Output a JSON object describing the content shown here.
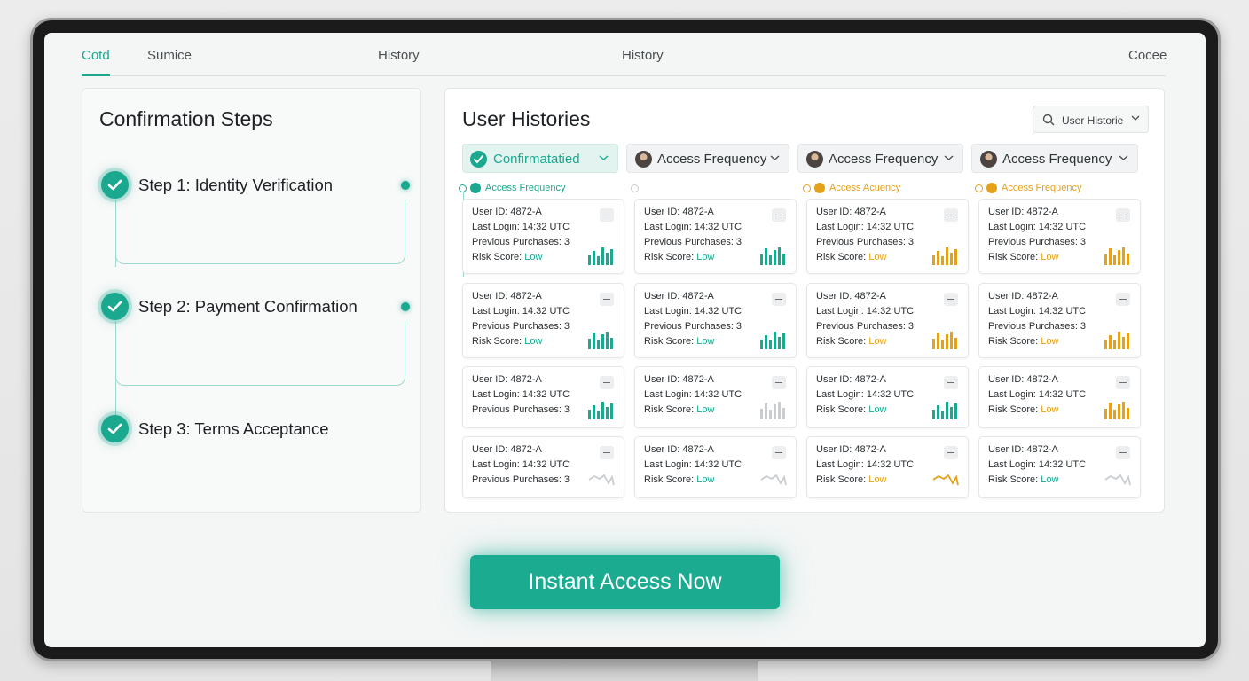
{
  "tabs": [
    {
      "label": "Cotd",
      "active": true
    },
    {
      "label": "Sumice",
      "active": false
    },
    {
      "label": "History",
      "active": false
    },
    {
      "label": "History",
      "active": false
    },
    {
      "label": "Cocee",
      "active": false
    }
  ],
  "confirmation": {
    "title": "Confirmation Steps",
    "steps": [
      {
        "label": "Step 1: Identity Verification",
        "done": true
      },
      {
        "label": "Step 2: Payment Confirmation",
        "done": true
      },
      {
        "label": "Step 3: Terms Acceptance",
        "done": true
      }
    ]
  },
  "histories": {
    "title": "User Histories",
    "search_label": "User Historie",
    "filters": [
      {
        "label": "Confirmatatied",
        "icon": "check-icon"
      },
      {
        "label": "Access Frequency",
        "icon": "avatar-icon"
      },
      {
        "label": "Access Frequency",
        "icon": "avatar-icon"
      },
      {
        "label": "Access Frequency",
        "icon": "avatar-icon"
      }
    ],
    "column_heads": [
      {
        "label": "Access Frequency",
        "color": "#1aa88f"
      },
      {
        "label": "",
        "color": ""
      },
      {
        "label": "Access Acuency",
        "color": "#e3a21a"
      },
      {
        "label": "Access Frequency",
        "color": "#e3a21a"
      }
    ],
    "field_labels": {
      "user_id": "User ID: 4872-A",
      "last_login": "Last Login: 14:32 UTC",
      "purchases": "Previous Purchases: 3",
      "risk": "Risk Score:",
      "risk_value": "Low"
    },
    "colors": {
      "teal": "#1aa88f",
      "amber": "#e3a21a",
      "gray": "#c9cdd0"
    },
    "rows": [
      [
        "uid,login,purch,risk|bars|teal",
        "uid,login,purch,risk|bars|teal",
        "uid,login,purch,risk|bars|amber",
        "uid,login,purch,risk|bars|amber"
      ],
      [
        "uid,login,purch,risk|bars|teal",
        "uid,login,purch,risk|bars|teal",
        "uid,login,purch,risk|bars|amber",
        "uid,login,purch,risk|bars|amber"
      ],
      [
        "uid,login,purch|bars|teal",
        "uid,login,risk|bars|gray",
        "uid,login,risk|bars|teal",
        "uid,login,risk|bars|amber"
      ],
      [
        "uid,login,purch|line|gray",
        "uid,login,risk|line|gray",
        "uid,login,risk|line|amber",
        "uid,login,risk|line|gray"
      ]
    ]
  },
  "cta": {
    "label": "Instant Access Now"
  }
}
